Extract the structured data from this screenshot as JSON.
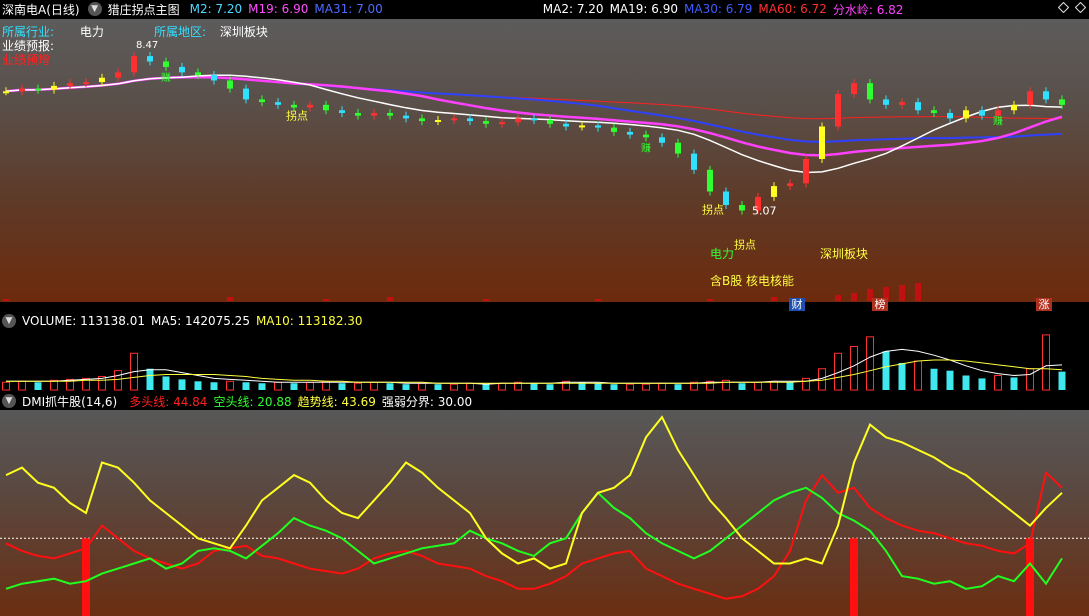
{
  "header": {
    "stock_name": "深南电A(日线)",
    "indicator_name": "猎庄拐点主图",
    "ma_left": [
      {
        "label": "M2: 7.20",
        "color": "#4fd8ff"
      },
      {
        "label": "M19: 6.90",
        "color": "#ff50ff"
      },
      {
        "label": "MA31: 7.00",
        "color": "#4f6bff"
      }
    ],
    "ma_right": [
      {
        "label": "MA2: 7.20",
        "color": "#ffffff"
      },
      {
        "label": "MA19: 6.90",
        "color": "#ffffff"
      },
      {
        "label": "MA30: 6.79",
        "color": "#3f5bff"
      },
      {
        "label": "MA60: 6.72",
        "color": "#ff3030"
      },
      {
        "label": "分水岭: 6.82",
        "color": "#ff40ff"
      }
    ]
  },
  "price_info": {
    "industry_label": "所属行业:",
    "industry_value": "电力",
    "region_label": "所属地区:",
    "region_value": "深圳板块",
    "forecast_label": "业绩预报:",
    "forecast_value": "业绩预增",
    "concept_industry": "电力",
    "concept_region": "深圳板块",
    "concept_tags": "含B股 核电核能",
    "high_label": "8.47",
    "low_label": "5.07",
    "turn_point": "拐点",
    "earn_mark": "赚",
    "bottom_tags": [
      {
        "text": "财",
        "color": "#1f4fb0"
      },
      {
        "text": "榜",
        "color": "#b03020"
      },
      {
        "text": "涨",
        "color": "#b03020"
      }
    ]
  },
  "volume_header": {
    "title": "VOLUME: 113138.01",
    "ma5": "MA5: 142075.25",
    "ma10": "MA10: 113182.30"
  },
  "dmi_header": {
    "title": "DMI抓牛股(14,6)",
    "long_line": "多头线: 44.84",
    "short_line": "空头线: 20.88",
    "trend_line": "趋势线: 43.69",
    "threshold": "强弱分界: 30.00"
  },
  "chart_data": [
    {
      "type": "line",
      "title": "猎庄拐点主图",
      "note": "approximate daily close prices read from the candle pane",
      "series": [
        {
          "name": "M2",
          "values": [
            7.45,
            7.5,
            7.48,
            7.55,
            7.6,
            7.62,
            7.7,
            7.8,
            8.1,
            8.0,
            7.9,
            7.8,
            7.75,
            7.65,
            7.5,
            7.3,
            7.25,
            7.2,
            7.15,
            7.2,
            7.1,
            7.05,
            7.0,
            7.05,
            7.0,
            6.95,
            6.9,
            6.92,
            6.95,
            6.9,
            6.85,
            6.88,
            6.95,
            6.92,
            6.85,
            6.8,
            6.82,
            6.78,
            6.7,
            6.65,
            6.6,
            6.5,
            6.3,
            6.0,
            5.6,
            5.35,
            5.25,
            5.5,
            5.7,
            5.75,
            6.2,
            6.8,
            7.4,
            7.6,
            7.3,
            7.2,
            7.25,
            7.1,
            7.05,
            6.95,
            7.1,
            7.0,
            7.1,
            7.2,
            7.45,
            7.3,
            7.2
          ]
        }
      ],
      "ylim": [
        5.0,
        8.6
      ]
    },
    {
      "type": "bar",
      "title": "VOLUME",
      "note": "approximate daily volume (relative units)",
      "values": [
        8,
        9,
        8,
        10,
        11,
        12,
        14,
        20,
        38,
        22,
        14,
        11,
        9,
        8,
        9,
        8,
        7,
        8,
        7,
        8,
        9,
        7,
        7,
        8,
        7,
        6,
        7,
        6,
        6,
        7,
        6,
        7,
        8,
        7,
        6,
        9,
        8,
        7,
        6,
        6,
        6,
        7,
        6,
        8,
        9,
        10,
        7,
        8,
        9,
        8,
        12,
        22,
        38,
        45,
        55,
        40,
        28,
        30,
        22,
        20,
        15,
        12,
        15,
        13,
        22,
        57,
        19
      ],
      "series": [
        {
          "name": "MA5",
          "values": [
            9,
            9,
            9,
            9,
            10,
            11,
            12,
            15,
            19,
            21,
            21,
            18,
            15,
            12,
            11,
            10,
            9,
            8,
            8,
            8,
            8,
            8,
            8,
            8,
            8,
            7,
            7,
            7,
            7,
            7,
            6,
            7,
            7,
            7,
            7,
            8,
            8,
            8,
            7,
            7,
            7,
            7,
            7,
            7,
            8,
            8,
            8,
            8,
            9,
            9,
            9,
            12,
            18,
            25,
            34,
            40,
            42,
            40,
            36,
            31,
            25,
            20,
            17,
            15,
            16,
            25,
            26
          ]
        },
        {
          "name": "MA10",
          "values": [
            9,
            9,
            9,
            9,
            9,
            10,
            10,
            11,
            13,
            15,
            16,
            16,
            16,
            16,
            15,
            14,
            12,
            11,
            10,
            10,
            9,
            9,
            8,
            8,
            8,
            8,
            8,
            7,
            7,
            7,
            7,
            7,
            7,
            7,
            7,
            7,
            7,
            7,
            7,
            7,
            7,
            7,
            7,
            7,
            7,
            8,
            8,
            8,
            8,
            8,
            9,
            10,
            13,
            16,
            20,
            24,
            27,
            30,
            31,
            31,
            30,
            28,
            26,
            24,
            22,
            22,
            21
          ]
        }
      ]
    },
    {
      "type": "line",
      "title": "DMI抓牛股(14,6)",
      "ylim": [
        0,
        80
      ],
      "threshold": 30,
      "series": [
        {
          "name": "多头线",
          "values": [
            28,
            25,
            23,
            22,
            24,
            26,
            35,
            30,
            25,
            22,
            20,
            18,
            20,
            25,
            26,
            27,
            23,
            22,
            20,
            18,
            17,
            16,
            18,
            22,
            24,
            25,
            23,
            20,
            19,
            18,
            15,
            13,
            10,
            10,
            12,
            15,
            20,
            22,
            24,
            25,
            18,
            15,
            12,
            10,
            8,
            6,
            7,
            10,
            15,
            25,
            45,
            55,
            48,
            50,
            42,
            38,
            35,
            33,
            32,
            30,
            28,
            27,
            25,
            24,
            28,
            56,
            50
          ]
        },
        {
          "name": "空头线",
          "values": [
            10,
            12,
            13,
            14,
            12,
            13,
            16,
            18,
            20,
            22,
            18,
            20,
            25,
            26,
            25,
            22,
            27,
            32,
            38,
            35,
            33,
            30,
            25,
            20,
            22,
            24,
            26,
            27,
            28,
            33,
            30,
            28,
            25,
            23,
            28,
            30,
            40,
            48,
            42,
            38,
            32,
            28,
            25,
            22,
            25,
            30,
            35,
            40,
            45,
            48,
            50,
            46,
            40,
            37,
            33,
            25,
            15,
            14,
            12,
            13,
            10,
            11,
            15,
            13,
            20,
            12,
            22
          ]
        },
        {
          "name": "趋势线",
          "values": [
            55,
            58,
            52,
            50,
            44,
            40,
            60,
            58,
            52,
            45,
            40,
            35,
            30,
            28,
            26,
            35,
            45,
            50,
            55,
            52,
            45,
            40,
            38,
            45,
            52,
            60,
            56,
            50,
            45,
            40,
            30,
            24,
            20,
            22,
            18,
            20,
            40,
            48,
            50,
            55,
            70,
            78,
            65,
            55,
            45,
            38,
            30,
            25,
            20,
            20,
            22,
            20,
            35,
            60,
            75,
            70,
            68,
            65,
            62,
            58,
            55,
            50,
            45,
            40,
            35,
            42,
            48
          ]
        }
      ]
    }
  ]
}
